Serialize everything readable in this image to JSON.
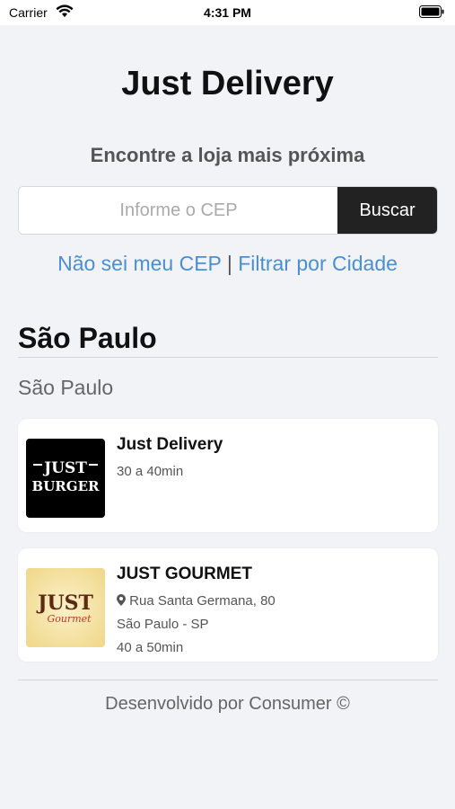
{
  "status_bar": {
    "carrier": "Carrier",
    "time": "4:31 PM"
  },
  "header": {
    "title": "Just Delivery",
    "subtitle": "Encontre a loja mais próxima"
  },
  "search": {
    "placeholder": "Informe o CEP",
    "value": "",
    "button_label": "Buscar"
  },
  "links": {
    "unknown_cep": "Não sei meu CEP",
    "separator": "|",
    "filter_city": "Filtrar por Cidade"
  },
  "section": {
    "city": "São Paulo",
    "sub_city": "São Paulo"
  },
  "stores": [
    {
      "name": "Just Delivery",
      "delivery_time": "30 a 40min",
      "logo_line1": "JUST",
      "logo_line2": "BURGER"
    },
    {
      "name": "JUST GOURMET",
      "address": "Rua Santa Germana, 80",
      "city_state": "São Paulo - SP",
      "delivery_time": "40 a 50min",
      "logo_line1": "JUST",
      "logo_line2": "Gourmet"
    }
  ],
  "footer": {
    "text": "Desenvolvido por Consumer ©"
  },
  "colors": {
    "background": "#f2f3f7",
    "link": "#4a8fd4",
    "button": "#222222"
  }
}
